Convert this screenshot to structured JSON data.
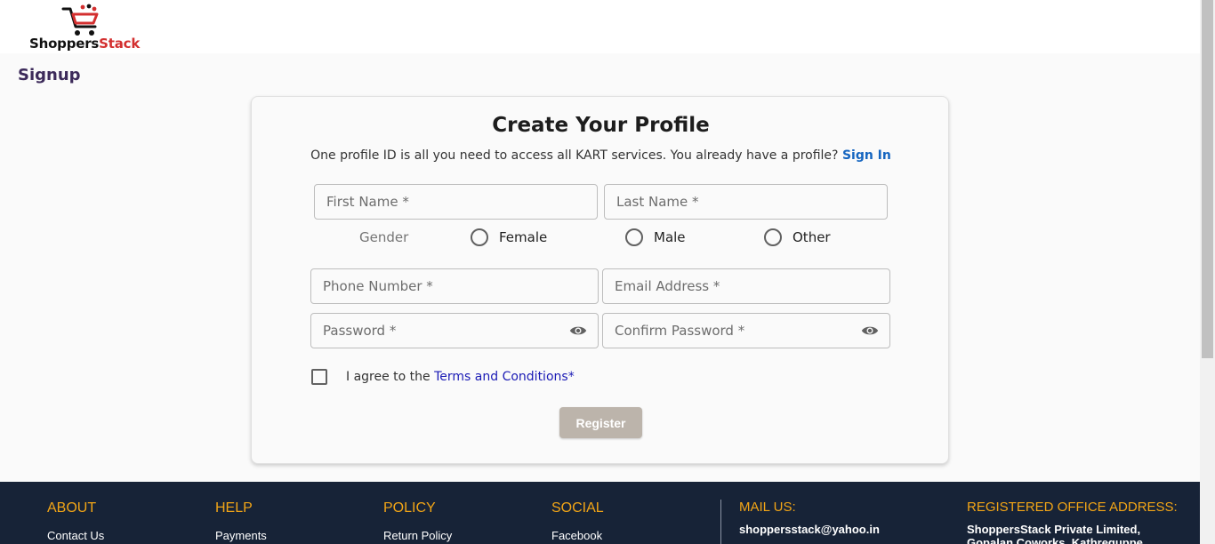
{
  "brand": {
    "name_part1": "Shoppers",
    "name_part2": "Stack",
    "accent_color": "#d32f2f"
  },
  "page": {
    "title": "Signup"
  },
  "card": {
    "title": "Create Your Profile",
    "subtitle": "One profile ID is all you need to access all KART services. You already have a profile?",
    "signin_link": "Sign In"
  },
  "form": {
    "first_name_placeholder": "First Name *",
    "last_name_placeholder": "Last Name *",
    "gender_label": "Gender",
    "gender_options": [
      "Female",
      "Male",
      "Other"
    ],
    "phone_placeholder": "Phone Number *",
    "email_placeholder": "Email Address *",
    "password_placeholder": "Password *",
    "confirm_password_placeholder": "Confirm Password *",
    "agree_prefix": "I agree to the",
    "terms_link": "Terms and Conditions",
    "required_mark": "*",
    "register_label": "Register"
  },
  "footer": {
    "about": {
      "heading": "ABOUT",
      "first_link": "Contact Us"
    },
    "help": {
      "heading": "HELP",
      "first_link": "Payments"
    },
    "policy": {
      "heading": "POLICY",
      "first_link": "Return Policy"
    },
    "social": {
      "heading": "SOCIAL",
      "first_link": "Facebook"
    },
    "mail": {
      "heading": "MAIL US:",
      "email": "shoppersstack@yahoo.in"
    },
    "office": {
      "heading": "REGISTERED OFFICE ADDRESS:",
      "line1": "ShoppersStack Private Limited,",
      "line2": "Gopalan Coworks, Kathreguppe"
    },
    "heading_color": "#f2a516",
    "background": "#172337"
  }
}
